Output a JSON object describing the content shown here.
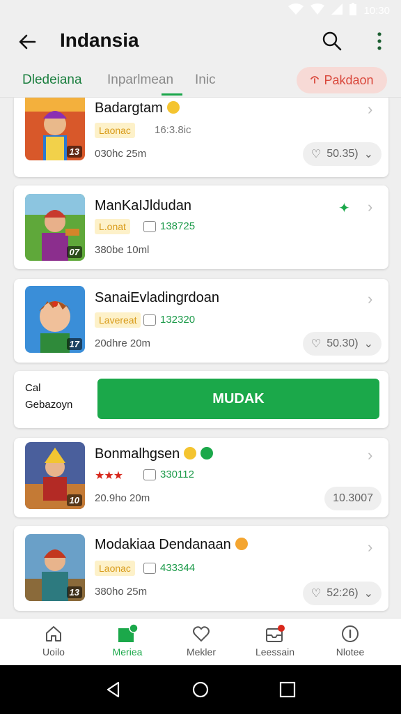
{
  "status": {
    "time": "10:30"
  },
  "appbar": {
    "title": "Indansia"
  },
  "tabs": [
    {
      "label": "Dledeiana"
    },
    {
      "label": "Inparlmean"
    },
    {
      "label": "Inic"
    }
  ],
  "chip": {
    "label": "Pakdaon"
  },
  "games": [
    {
      "name": "Badargtam",
      "tag": "Laonac",
      "count": "16:3.8ic",
      "meta": "030hc 25m",
      "pill": "50.35)",
      "level": "13",
      "count_style": "gray"
    },
    {
      "name": "ManKaIJldudan",
      "tag": "L.onat",
      "count": "138725",
      "meta": "380be 10ml",
      "pill": "",
      "level": "07",
      "count_style": "green"
    },
    {
      "name": "SanaiEvladingrdoan",
      "tag": "Lavereat",
      "count": "132320",
      "meta": "20dhre 20m",
      "pill": "50.30)",
      "level": "17",
      "count_style": "green"
    },
    {
      "name": "Bonmalhgsen",
      "tag": "",
      "count": "330112",
      "meta": "20.9ho 20m",
      "pill": "10.3007",
      "level": "10",
      "count_style": "green"
    },
    {
      "name": "Modakiaa Dendanaan",
      "tag": "Laonac",
      "count": "433344",
      "meta": "380ho 25m",
      "pill": "52:26)",
      "level": "13",
      "count_style": "green"
    }
  ],
  "promo": {
    "line1": "Cal",
    "line2": "Gebazoyn",
    "button": "MUDAK"
  },
  "bottom_nav": [
    {
      "label": "Uoilo",
      "icon": "home-icon"
    },
    {
      "label": "Meriea",
      "icon": "store-icon"
    },
    {
      "label": "Mekler",
      "icon": "heart-search-icon"
    },
    {
      "label": "Leessain",
      "icon": "inbox-icon"
    },
    {
      "label": "Nlotee",
      "icon": "info-icon"
    }
  ],
  "colors": {
    "accent": "#1ba84a",
    "chip_bg": "#f7dad6",
    "chip_text": "#d9473b"
  }
}
